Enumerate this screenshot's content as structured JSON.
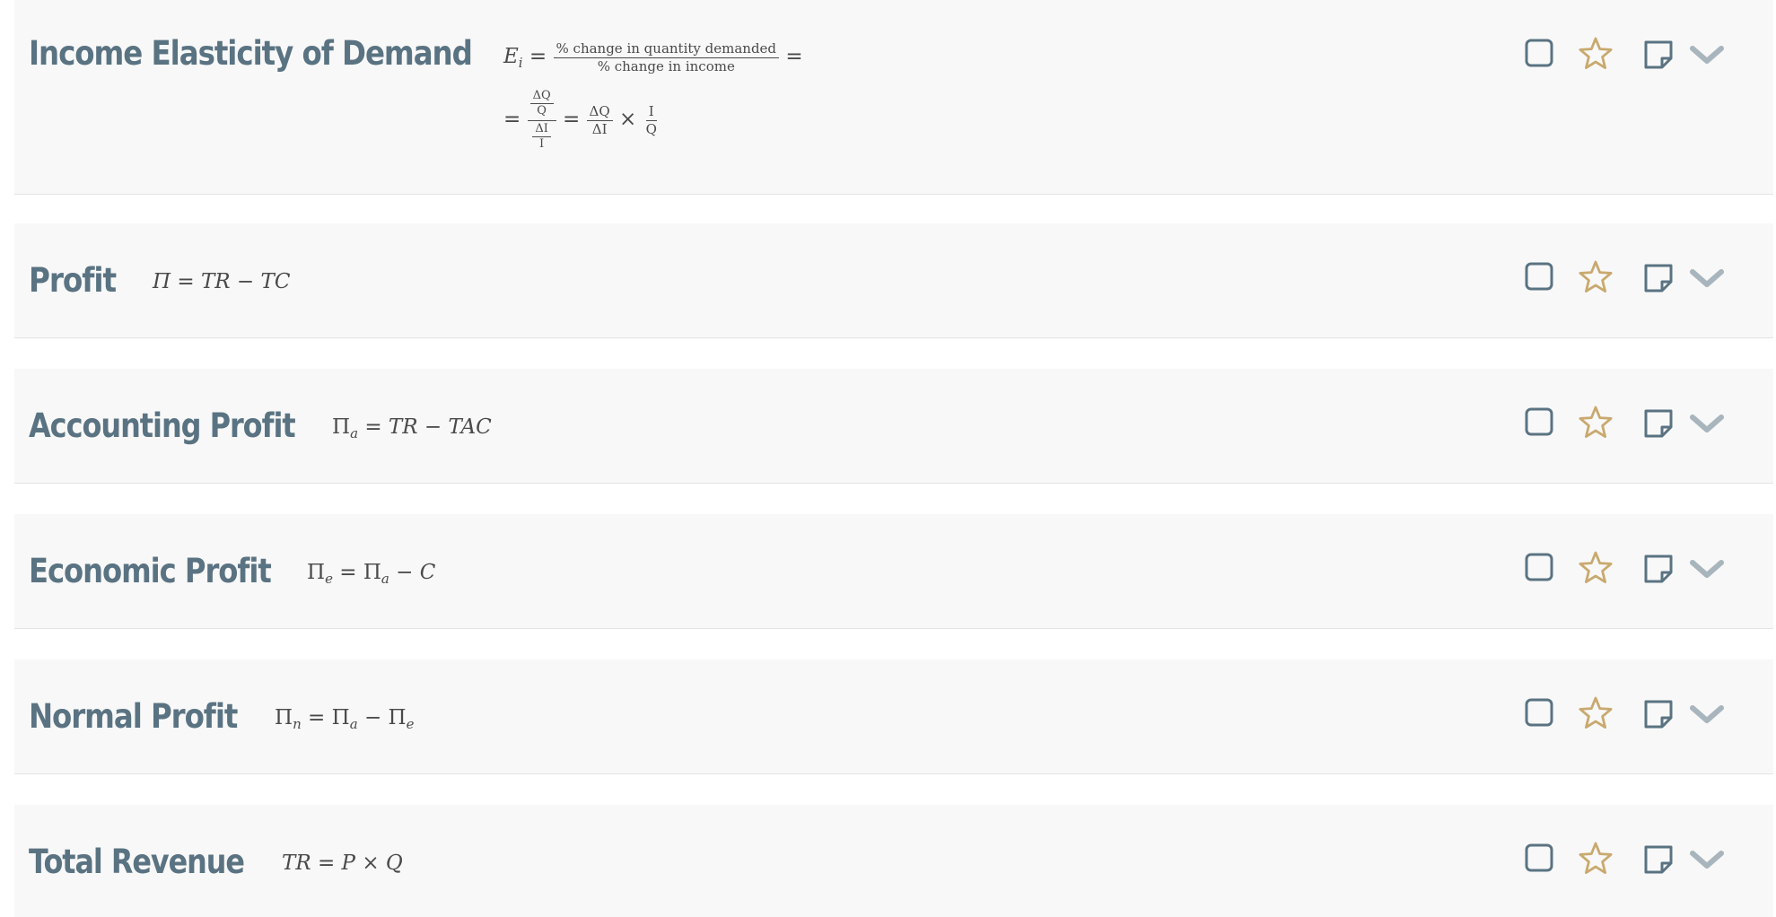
{
  "cards": [
    {
      "title": "Income Elasticity of Demand",
      "formula_line1": {
        "lhs_var": "E",
        "lhs_sub": "i",
        "eq": "=",
        "frac_num": "% change in quantity demanded",
        "frac_den": "% change in income",
        "trail_eq": "="
      },
      "formula_line2": {
        "eq1": "=",
        "top_num": "ΔQ",
        "top_den": "Q",
        "bot_num": "ΔI",
        "bot_den": "I",
        "eq2": "=",
        "f1_num": "ΔQ",
        "f1_den": "ΔI",
        "times": "×",
        "f2_num": "I",
        "f2_den": "Q"
      }
    },
    {
      "title": "Profit",
      "formula": "Π = TR − TC"
    },
    {
      "title": "Accounting Profit",
      "formula": {
        "base": "Π",
        "sub": "a",
        "rest": " = TR − TAC"
      }
    },
    {
      "title": "Economic Profit",
      "formula": {
        "base": "Π",
        "sub": "e",
        "mid": " = Π",
        "sub2": "a",
        "rest": " − C"
      }
    },
    {
      "title": "Normal Profit",
      "formula": {
        "base": "Π",
        "sub": "n",
        "mid": " = Π",
        "sub2": "a",
        "mid2": " − Π",
        "sub3": "e"
      }
    },
    {
      "title": "Total Revenue",
      "formula": "TR = P × Q"
    }
  ],
  "icons": {
    "checkbox": "checkbox-icon",
    "favorite": "star-icon",
    "note": "note-icon",
    "expand": "chevron-down-icon"
  },
  "colors": {
    "title": "#5a7382",
    "icon_slate": "#5a7382",
    "star": "#c9a96e",
    "chevron": "#a8b5bd",
    "card_bg": "#f8f8f8"
  }
}
